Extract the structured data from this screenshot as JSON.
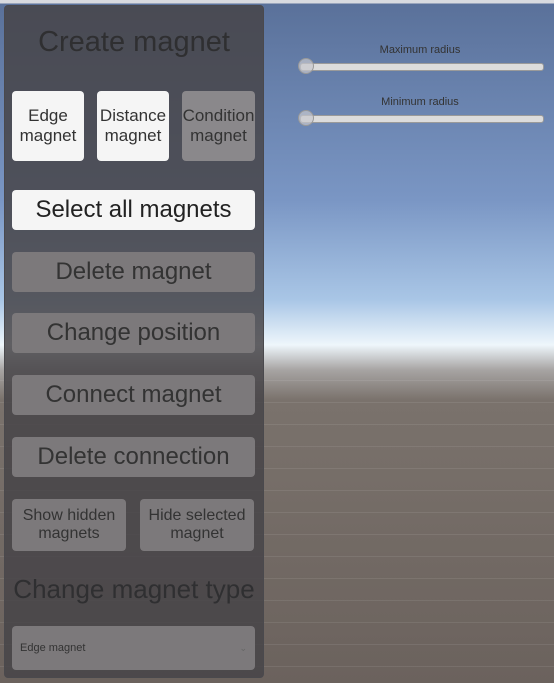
{
  "panel": {
    "title": "Create magnet",
    "type_buttons": [
      {
        "label": "Edge magnet",
        "active": true
      },
      {
        "label": "Distance magnet",
        "active": true
      },
      {
        "label": "Condition magnet",
        "active": false
      }
    ],
    "select_all": "Select all magnets",
    "delete_magnet": "Delete magnet",
    "change_position": "Change position",
    "connect_magnet": "Connect magnet",
    "delete_connection": "Delete connection",
    "show_hidden": "Show hidden magnets",
    "hide_selected": "Hide selected magnet",
    "change_type_title": "Change magnet type",
    "dropdown_value": "Edge magnet"
  },
  "sliders": [
    {
      "label": "Maximum radius",
      "value": 0
    },
    {
      "label": "Minimum radius",
      "value": 0
    }
  ]
}
